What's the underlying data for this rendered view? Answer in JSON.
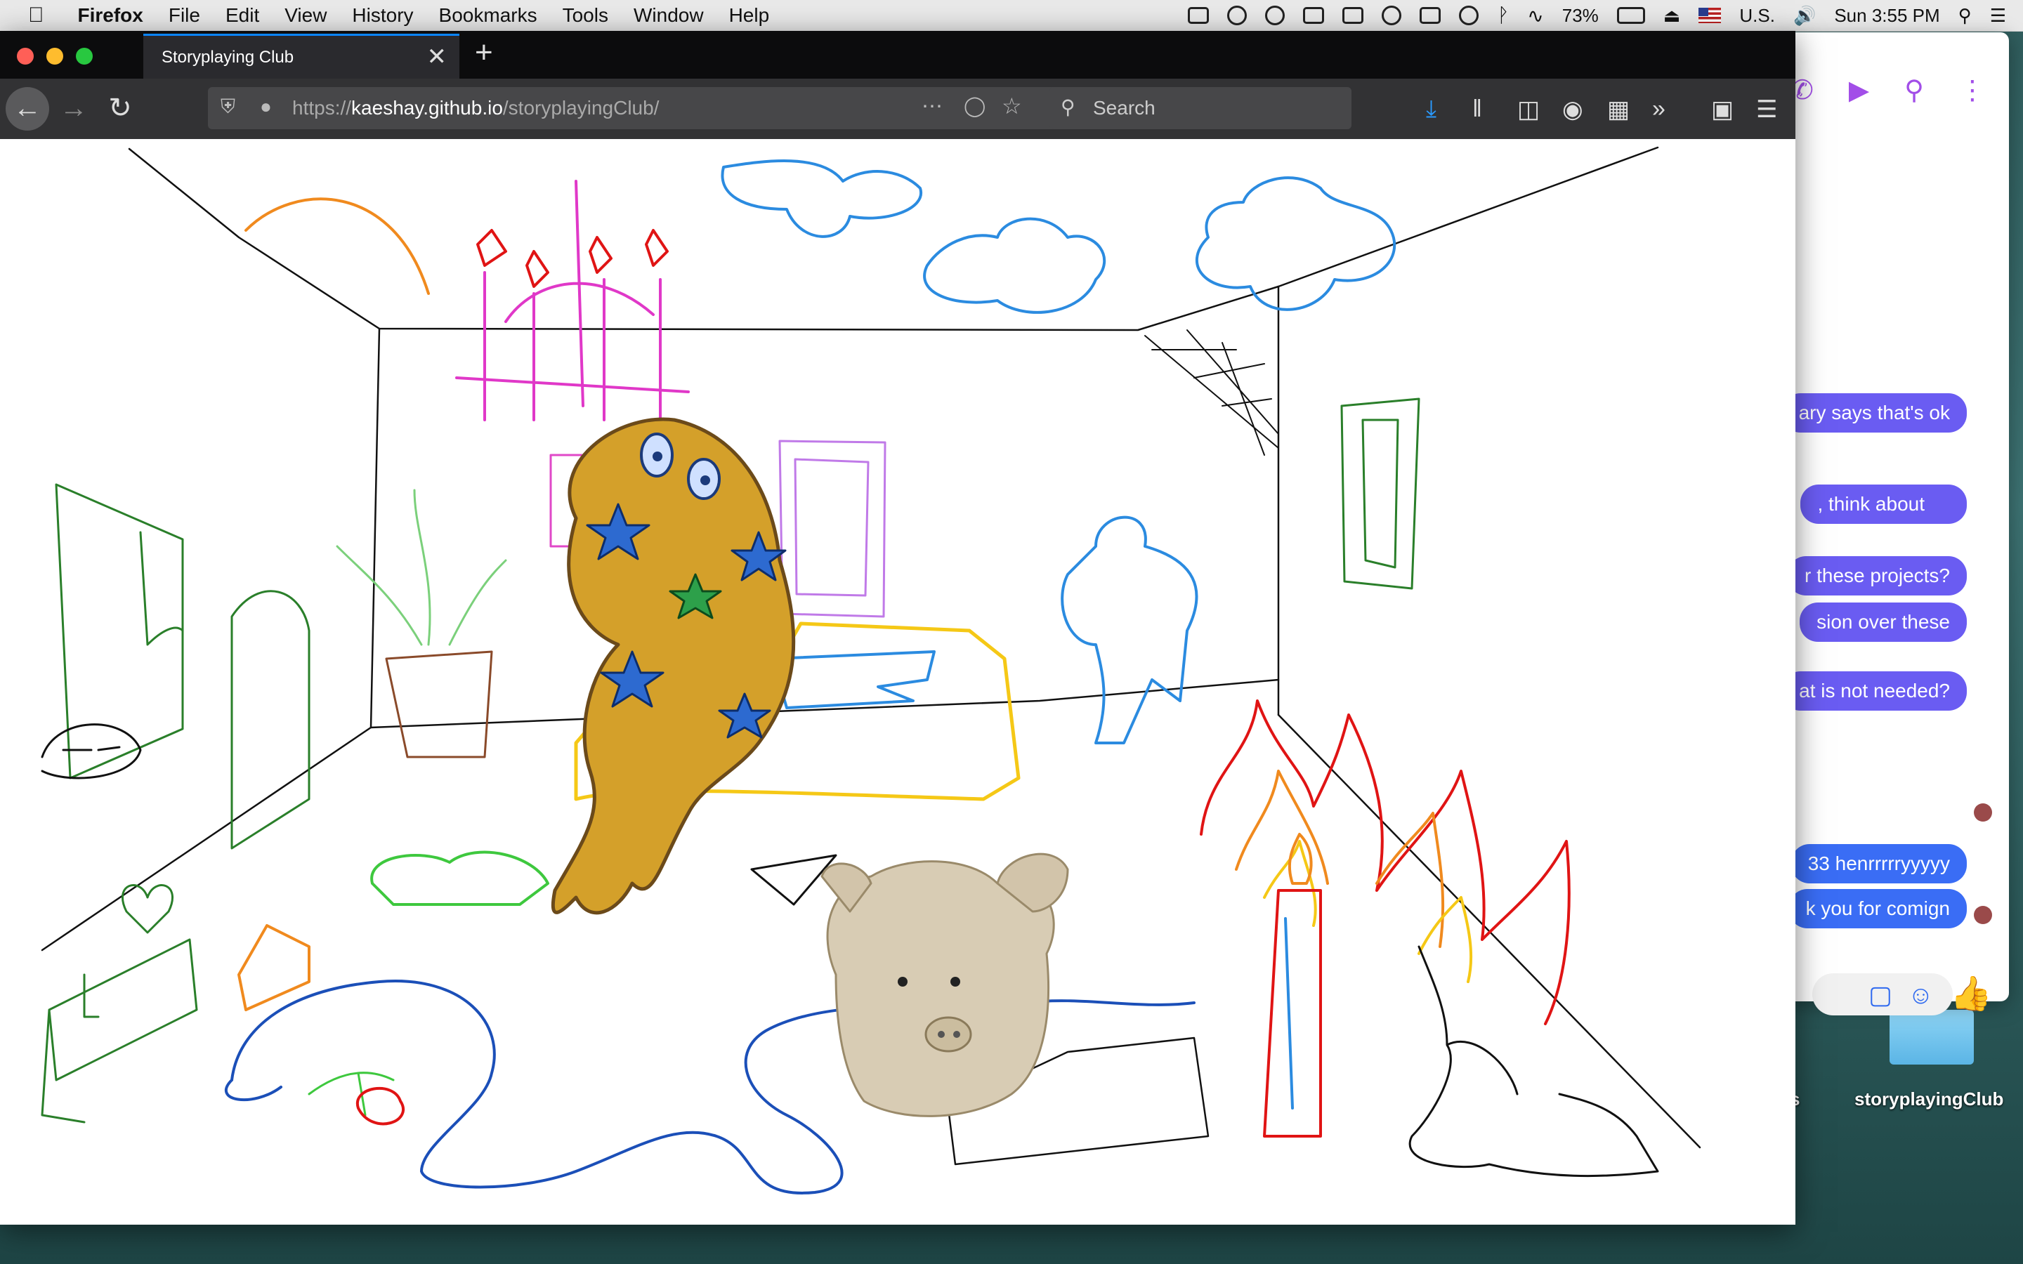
{
  "menubar": {
    "app": "Firefox",
    "items": [
      "File",
      "Edit",
      "View",
      "History",
      "Bookmarks",
      "Tools",
      "Window",
      "Help"
    ],
    "battery": "73%",
    "input_source": "U.S.",
    "clock": "Sun 3:55 PM"
  },
  "browser": {
    "tab_title": "Storyplaying Club",
    "url_prefix": "https://",
    "url_domain": "kaeshay.github.io",
    "url_path": "/storyplayingClub/",
    "search_placeholder": "Search"
  },
  "messenger": {
    "messages": [
      "ary says that's ok",
      ", think about",
      "r these projects?",
      "sion over these",
      "at is not needed?",
      "33 henrrrrryyyyy",
      "k you for comign"
    ]
  },
  "desktop": {
    "folder_label": "storyplayingClub",
    "partial_label": "s"
  },
  "colors": {
    "accent": "#0a84ff",
    "messenger_purple": "#a24ee8",
    "bubble_purple": "#6a5cf2",
    "bubble_blue": "#3a6df5"
  }
}
